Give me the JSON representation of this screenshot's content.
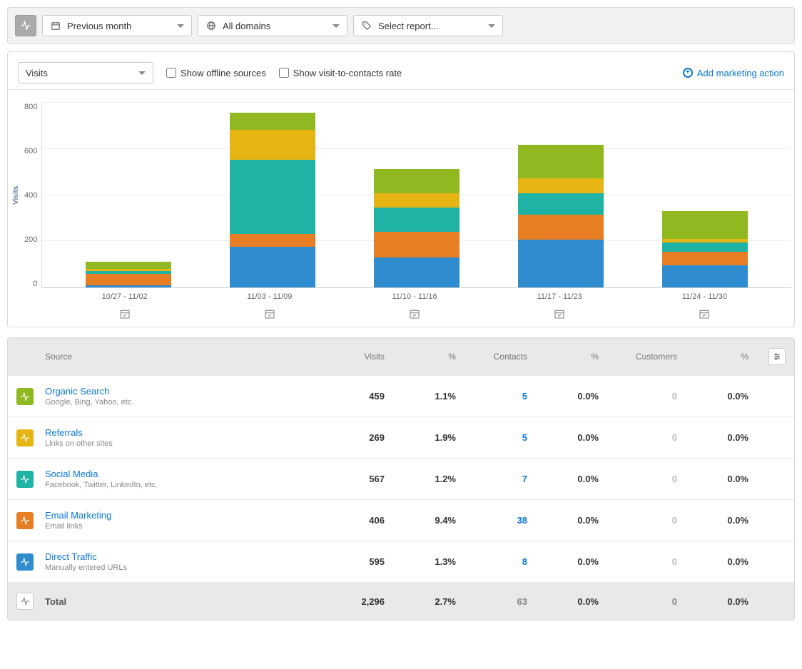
{
  "toolbar": {
    "date_filter_label": "Previous month",
    "domain_filter_label": "All domains",
    "report_filter_label": "Select report..."
  },
  "subtoolbar": {
    "metric_select_label": "Visits",
    "show_offline_label": "Show offline sources",
    "show_conversion_label": "Show visit-to-contacts rate",
    "add_action_label": "Add marketing action"
  },
  "chart": {
    "y_axis_label": "Visits",
    "y_ticks": [
      "800",
      "600",
      "400",
      "200",
      "0"
    ]
  },
  "chart_data": {
    "type": "bar",
    "stacked": true,
    "ylabel": "Visits",
    "ylim": [
      0,
      800
    ],
    "categories": [
      "10/27 - 11/02",
      "11/03 - 11/09",
      "11/10 - 11/16",
      "11/17 - 11/23",
      "11/24 - 11/30"
    ],
    "series": [
      {
        "name": "Direct Traffic",
        "color": "#2e8ccf",
        "values": [
          10,
          175,
          130,
          205,
          95
        ]
      },
      {
        "name": "Email Marketing",
        "color": "#e77e23",
        "values": [
          50,
          55,
          110,
          110,
          60
        ]
      },
      {
        "name": "Social Media",
        "color": "#1fb3a5",
        "values": [
          10,
          320,
          105,
          90,
          40
        ]
      },
      {
        "name": "Referrals",
        "color": "#e6b413",
        "values": [
          10,
          130,
          60,
          65,
          15
        ]
      },
      {
        "name": "Organic Search",
        "color": "#8fb821",
        "values": [
          30,
          75,
          105,
          145,
          120
        ]
      }
    ]
  },
  "table": {
    "headers": {
      "source": "Source",
      "visits": "Visits",
      "visits_pct": "%",
      "contacts": "Contacts",
      "contacts_pct": "%",
      "customers": "Customers",
      "customers_pct": "%"
    },
    "rows": [
      {
        "icon_color": "#8fb821",
        "name": "Organic Search",
        "sub": "Google, Bing, Yahoo, etc.",
        "visits": "459",
        "visits_pct": "1.1%",
        "contacts": "5",
        "contacts_pct": "0.0%",
        "customers": "0",
        "customers_pct": "0.0%"
      },
      {
        "icon_color": "#e6b413",
        "name": "Referrals",
        "sub": "Links on other sites",
        "visits": "269",
        "visits_pct": "1.9%",
        "contacts": "5",
        "contacts_pct": "0.0%",
        "customers": "0",
        "customers_pct": "0.0%"
      },
      {
        "icon_color": "#1fb3a5",
        "name": "Social Media",
        "sub": "Facebook, Twitter, LinkedIn, etc.",
        "visits": "567",
        "visits_pct": "1.2%",
        "contacts": "7",
        "contacts_pct": "0.0%",
        "customers": "0",
        "customers_pct": "0.0%"
      },
      {
        "icon_color": "#e77e23",
        "name": "Email Marketing",
        "sub": "Email links",
        "visits": "406",
        "visits_pct": "9.4%",
        "contacts": "38",
        "contacts_pct": "0.0%",
        "customers": "0",
        "customers_pct": "0.0%"
      },
      {
        "icon_color": "#2e8ccf",
        "name": "Direct Traffic",
        "sub": "Manually entered URLs",
        "visits": "595",
        "visits_pct": "1.3%",
        "contacts": "8",
        "contacts_pct": "0.0%",
        "customers": "0",
        "customers_pct": "0.0%"
      }
    ],
    "total": {
      "name": "Total",
      "visits": "2,296",
      "visits_pct": "2.7%",
      "contacts": "63",
      "contacts_pct": "0.0%",
      "customers": "0",
      "customers_pct": "0.0%"
    }
  }
}
